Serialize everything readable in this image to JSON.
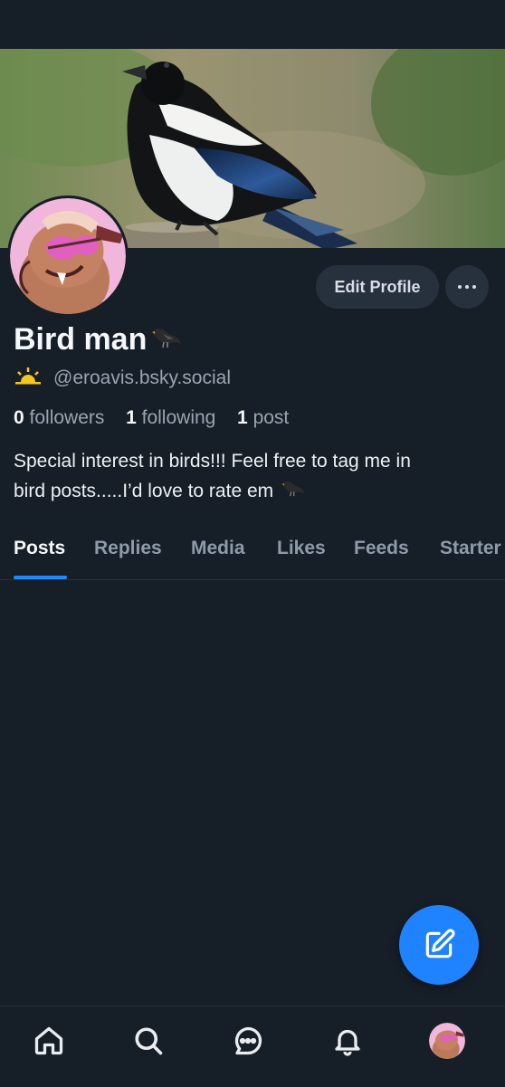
{
  "profile": {
    "display_name": "Bird man",
    "handle": "@eroavis.bsky.social",
    "bio_line1": "Special interest in birds!!! Feel free to tag me in",
    "bio_line2": "bird posts.....I’d love to rate em",
    "name_emoji": "blackbird-emoji",
    "handle_emoji": "sunrise-emoji"
  },
  "stats": {
    "followers_count": "0",
    "followers_label": "followers",
    "following_count": "1",
    "following_label": "following",
    "posts_count": "1",
    "posts_label": "post"
  },
  "actions": {
    "edit_profile_label": "Edit Profile",
    "more_icon": "ellipsis-icon"
  },
  "tabs": [
    {
      "label": "Posts",
      "active": true
    },
    {
      "label": "Replies",
      "active": false
    },
    {
      "label": "Media",
      "active": false
    },
    {
      "label": "Likes",
      "active": false
    },
    {
      "label": "Feeds",
      "active": false
    },
    {
      "label": "Starter",
      "active": false
    }
  ],
  "fab": {
    "icon": "compose-icon"
  },
  "bottom_nav": [
    {
      "icon": "home-icon"
    },
    {
      "icon": "search-icon"
    },
    {
      "icon": "chat-icon"
    },
    {
      "icon": "bell-icon"
    },
    {
      "icon": "profile-avatar"
    }
  ],
  "colors": {
    "background": "#161e27",
    "accent": "#1f83ff",
    "button_bg": "#26313d",
    "muted_text": "#9aa5b1"
  }
}
